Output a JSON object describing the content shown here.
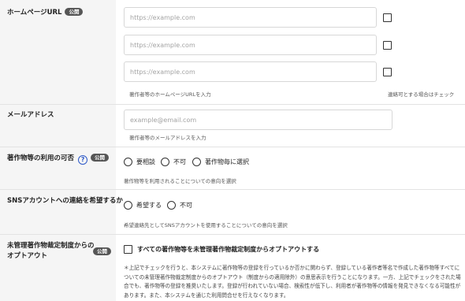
{
  "homepage": {
    "label": "ホームページURL",
    "badge": "公開",
    "placeholders": [
      "https://example.com",
      "https://example.com",
      "https://example.com"
    ],
    "hint": "著作者等のホームページURLを入力",
    "check_hint": "連絡可とする場合はチェック"
  },
  "email": {
    "label": "メールアドレス",
    "placeholder": "example@email.com",
    "hint": "著作者等のメールアドレスを入力"
  },
  "usage": {
    "label": "著作物等の利用の可否",
    "help": "?",
    "badge": "公開",
    "options": [
      "要相談",
      "不可",
      "著作物毎に選択"
    ],
    "hint": "著作物等を利用されることについての意向を選択"
  },
  "sns": {
    "label": "SNSアカウントへの連絡を希望するか",
    "options": [
      "希望する",
      "不可"
    ],
    "hint": "希望連絡先としてSNSアカウントを使用することについての意向を選択"
  },
  "optout": {
    "label_line1": "未管理著作物裁定制度からの",
    "label_line2": "オプトアウト",
    "badge": "公開",
    "checkbox_label": "すべての著作物等を未管理著作物裁定制度からオプトアウトする",
    "note": "＊上記でチェックを行うと、本システムに著作物等の登録を行っているか否かに関わらず、登録している著作者等名で作成した著作物等すべてについての未管理著作物裁定制度からのオプトアウト（制度からの適用除外）の意思表示を行うことになります。一方、上記でチェックをされた場合でも、著作物等の登録を推奨いたします。登録が行われていない場合、検索性が低下し、利用者が著作物等の情報を発見できなくなる可能性があります。また、本システムを通じた利用問合せを行えなくなります。"
  }
}
